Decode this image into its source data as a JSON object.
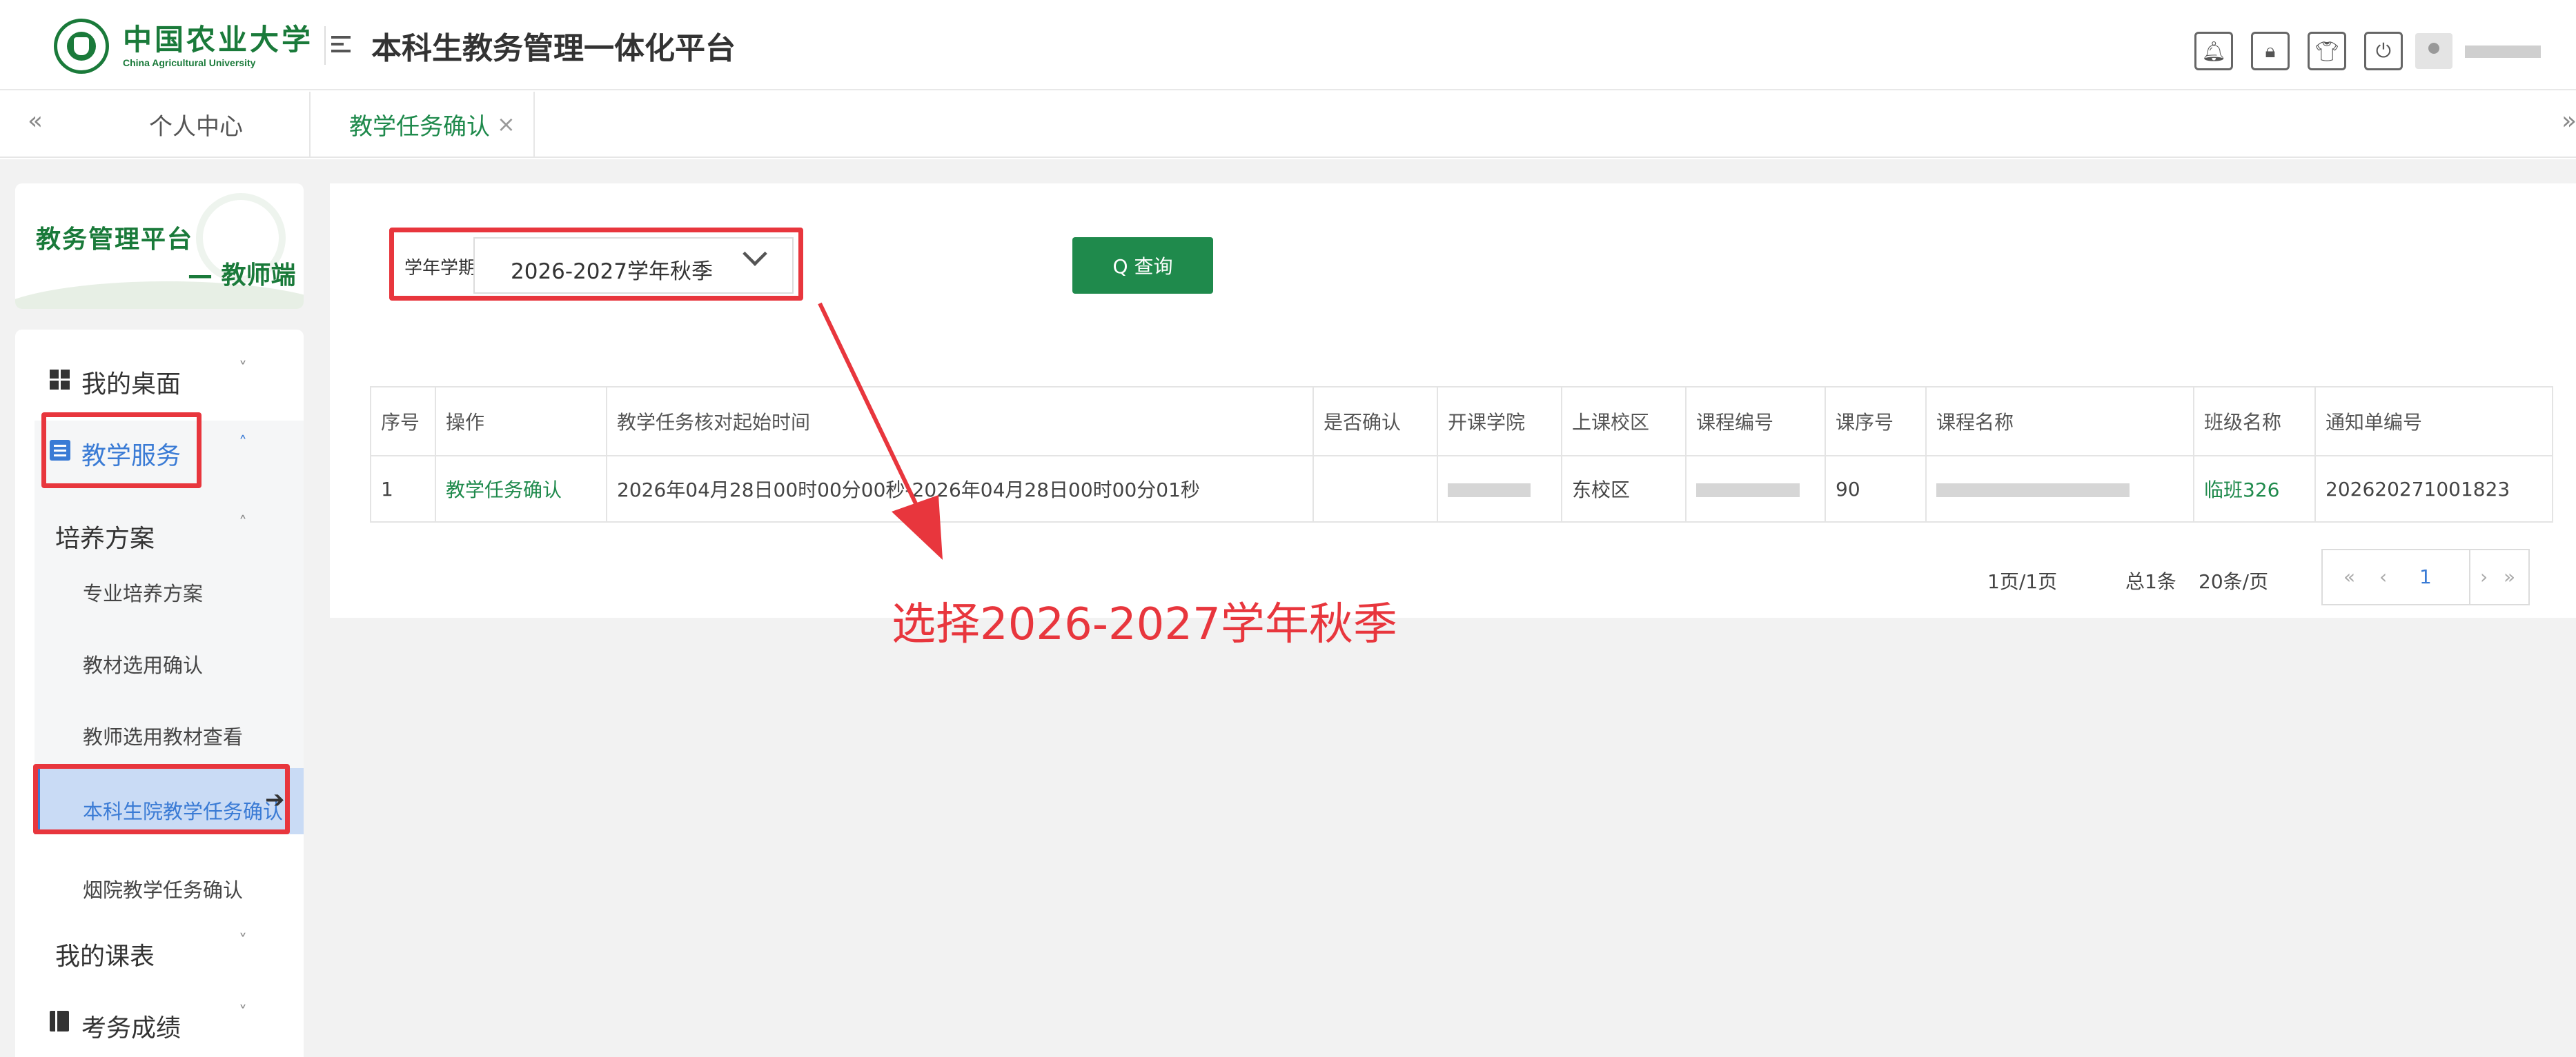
{
  "header": {
    "logo_cn": "中国农业大学",
    "logo_en": "China Agricultural University",
    "title": "本科生教务管理一体化平台",
    "icons": [
      "bell-icon",
      "lock-icon",
      "shirt-icon",
      "power-icon"
    ]
  },
  "tabs": {
    "prev": "«",
    "home": "个人中心",
    "active": "教学任务确认",
    "close": "×",
    "next": "»"
  },
  "sidebar": {
    "brand_title": "教务管理平台",
    "brand_sub": "— 教师端",
    "desk": "我的桌面",
    "teach": "教学服务",
    "plan": "培养方案",
    "subs": [
      "专业培养方案",
      "教材选用确认",
      "教师选用教材查看",
      "本科生院教学任务确认",
      "烟院教学任务确认"
    ],
    "schedule": "我的课表",
    "exam": "考务成绩",
    "chev_down": "˅",
    "chev_up": "˄"
  },
  "filter": {
    "label": "学年学期",
    "value": "2026-2027学年秋季",
    "query": "Q 查询"
  },
  "table": {
    "headers": [
      "序号",
      "操作",
      "教学任务核对起始时间",
      "是否确认",
      "开课学院",
      "上课校区",
      "课程编号",
      "课序号",
      "课程名称",
      "班级名称",
      "通知单编号"
    ],
    "rows": [
      [
        "1",
        "教学任务确认",
        "2026年04月28日00时00分00秒-2026年04月28日00时00分01秒",
        "",
        "",
        "东校区",
        "",
        "90",
        "",
        "临班326",
        "202620271001823"
      ]
    ]
  },
  "pagination": {
    "info": "1页/1页",
    "total": "总1条",
    "size": "20条/页",
    "first": "«",
    "prev": "‹",
    "current": "1",
    "next": "›",
    "last": "»"
  },
  "annotation": "选择2026-2027学年秋季",
  "colors": {
    "brand_green": "#1f8a4c",
    "accent_blue": "#3a7bd5",
    "highlight_red": "#e8363d"
  }
}
